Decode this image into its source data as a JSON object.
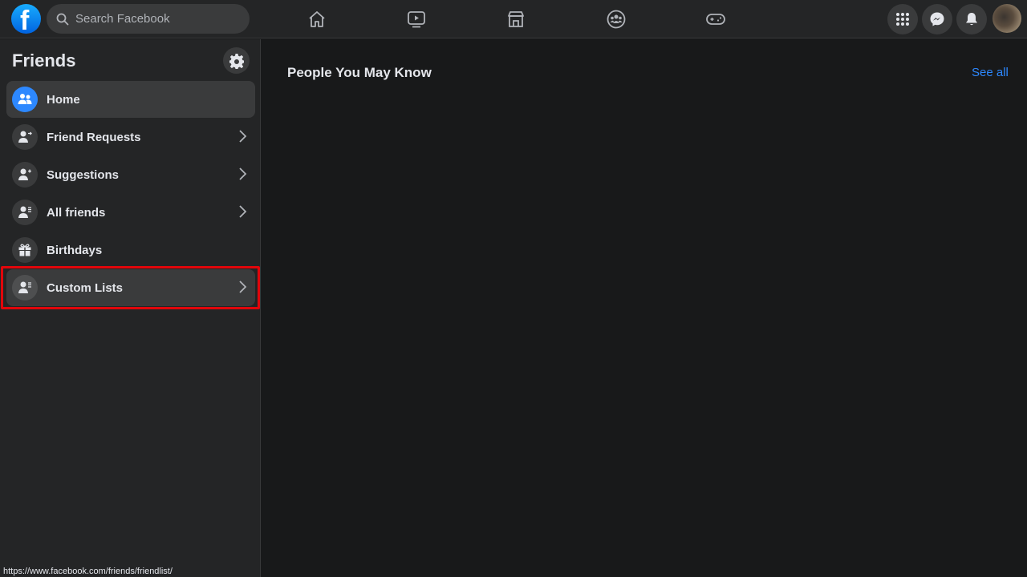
{
  "topbar": {
    "logo_letter": "f",
    "search_placeholder": "Search Facebook",
    "nav_icons": [
      "home-icon",
      "watch-icon",
      "marketplace-icon",
      "groups-icon",
      "gaming-icon"
    ],
    "right_icons": [
      "menu-grid-icon",
      "messenger-icon",
      "notifications-icon"
    ]
  },
  "sidebar": {
    "title": "Friends",
    "items": [
      {
        "label": "Home",
        "icon": "friends-icon",
        "active": true,
        "chevron": false
      },
      {
        "label": "Friend Requests",
        "icon": "friend-request-icon",
        "active": false,
        "chevron": true
      },
      {
        "label": "Suggestions",
        "icon": "add-friend-icon",
        "active": false,
        "chevron": true
      },
      {
        "label": "All friends",
        "icon": "friend-list-icon",
        "active": false,
        "chevron": true
      },
      {
        "label": "Birthdays",
        "icon": "gift-icon",
        "active": false,
        "chevron": false
      },
      {
        "label": "Custom Lists",
        "icon": "custom-list-icon",
        "active": false,
        "chevron": true,
        "highlighted": true
      }
    ]
  },
  "main": {
    "section_title": "People You May Know",
    "see_all": "See all"
  },
  "status_url": "https://www.facebook.com/friends/friendlist/",
  "colors": {
    "accent": "#2d88ff",
    "highlight": "#e1060b",
    "background": "#18191a",
    "surface": "#242526"
  }
}
